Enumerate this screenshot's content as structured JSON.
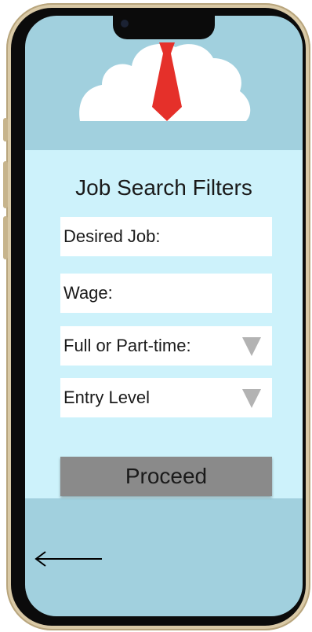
{
  "form": {
    "title": "Job Search Filters",
    "desired_job_placeholder": "Desired Job:",
    "wage_placeholder": "Wage:",
    "employment_type_selected": "Full or Part-time:",
    "experience_level_selected": "Entry Level",
    "proceed_label": "Proceed"
  },
  "icons": {
    "logo": "cloud-tie-logo",
    "back": "back-arrow-icon",
    "dropdown": "chevron-down-icon"
  },
  "colors": {
    "screen_bg": "#a1d0de",
    "panel_bg": "#cdf2fb",
    "button_bg": "#8a8a8a",
    "tie": "#e5302a"
  }
}
